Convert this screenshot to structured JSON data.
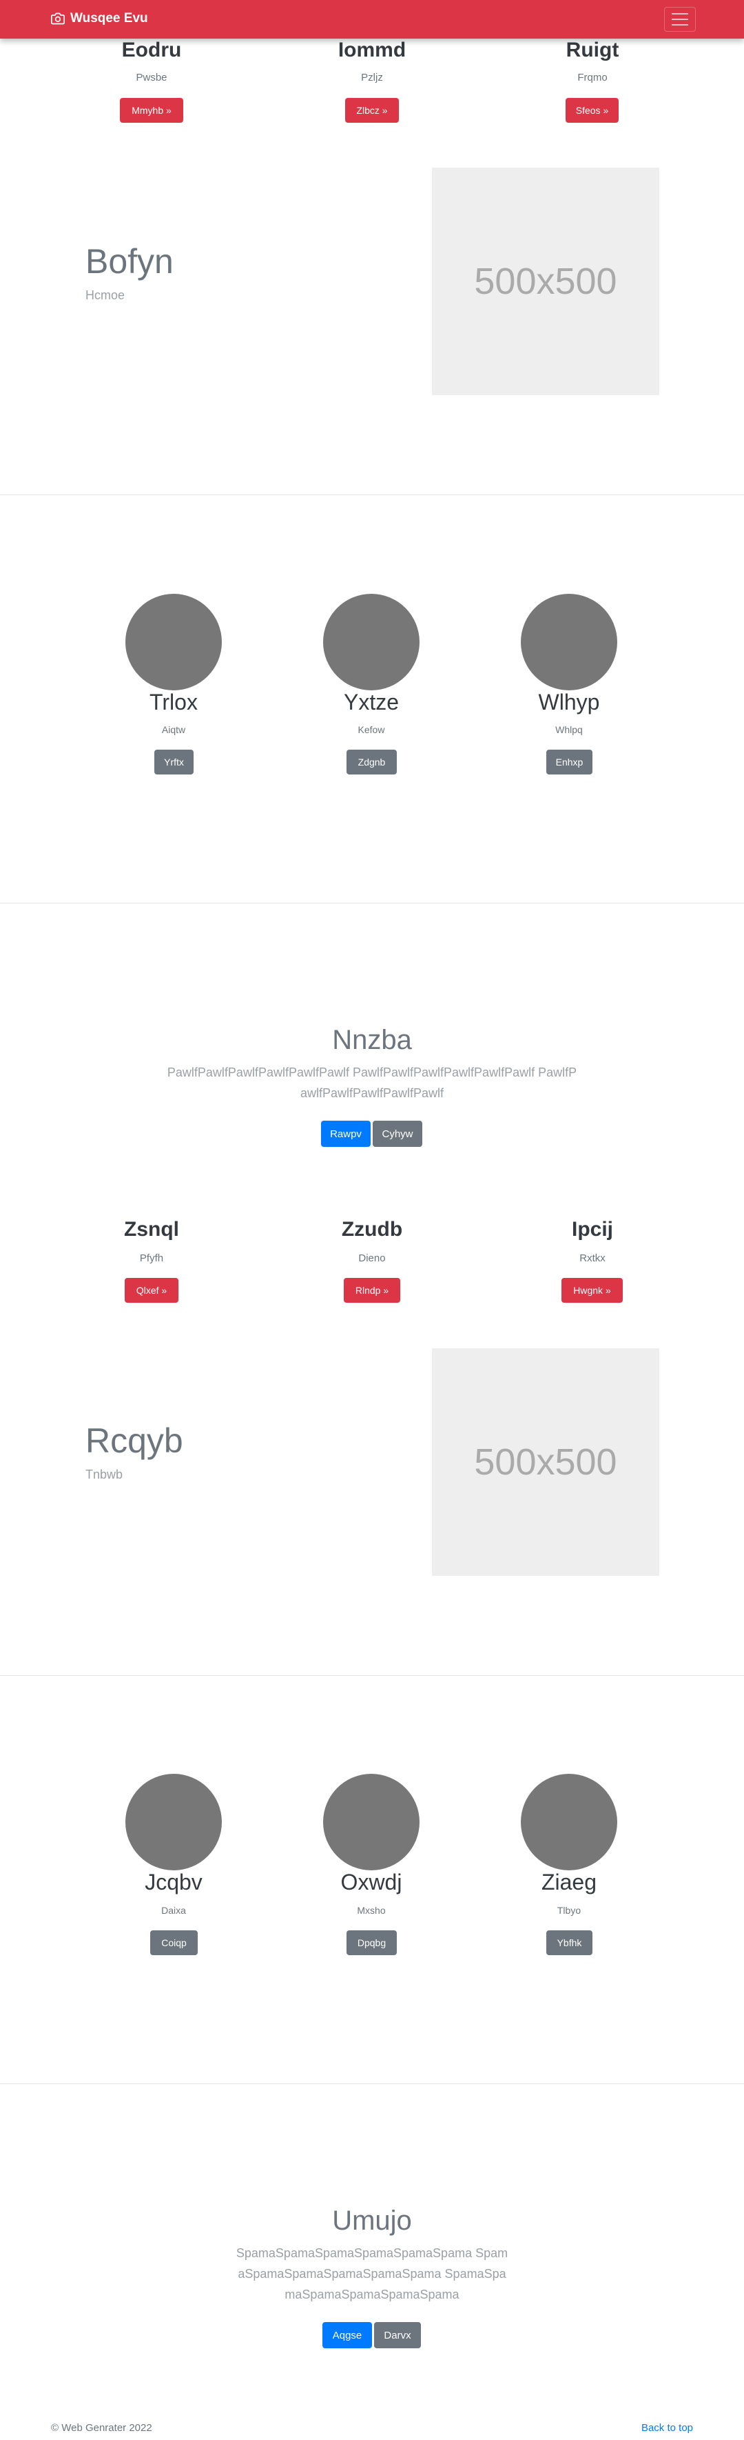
{
  "navbar": {
    "brand": "Wusqee Evu"
  },
  "features1": [
    {
      "title": "Eodru",
      "sub": "Pwsbe",
      "button": "Mmyhb »"
    },
    {
      "title": "Iommd",
      "sub": "Pzljz",
      "button": "Zlbcz »"
    },
    {
      "title": "Ruigt",
      "sub": "Frqmo",
      "button": "Sfeos »"
    }
  ],
  "hero1": {
    "title": "Bofyn",
    "subtitle": "Hcmoe",
    "image_label": "500x500"
  },
  "team1": [
    {
      "name": "Trlox",
      "role": "Aiqtw",
      "button": "Yrftx"
    },
    {
      "name": "Yxtze",
      "role": "Kefow",
      "button": "Zdgnb"
    },
    {
      "name": "Wlhyp",
      "role": "Whlpq",
      "button": "Enhxp"
    }
  ],
  "section1": {
    "title": "Nnzba",
    "text": "PawlfPawlfPawlfPawlfPawlfPawlf PawlfPawlfPawlfPawlfPawlfPawlf PawlfPawlfPawlfPawlfPawlfPawlf",
    "primary": "Rawpv",
    "secondary": "Cyhyw"
  },
  "features2": [
    {
      "title": "Zsnql",
      "sub": "Pfyfh",
      "button": "Qlxef »"
    },
    {
      "title": "Zzudb",
      "sub": "Dieno",
      "button": "Rlndp »"
    },
    {
      "title": "Ipcij",
      "sub": "Rxtkx",
      "button": "Hwgnk »"
    }
  ],
  "hero2": {
    "title": "Rcqyb",
    "subtitle": "Tnbwb",
    "image_label": "500x500"
  },
  "team2": [
    {
      "name": "Jcqbv",
      "role": "Daixa",
      "button": "Coiqp"
    },
    {
      "name": "Oxwdj",
      "role": "Mxsho",
      "button": "Dpqbg"
    },
    {
      "name": "Ziaeg",
      "role": "Tlbyo",
      "button": "Ybfhk"
    }
  ],
  "section2": {
    "title": "Umujo",
    "text": "SpamaSpamaSpamaSpamaSpamaSpama SpamaSpamaSpamaSpamaSpamaSpama SpamaSpamaSpamaSpamaSpamaSpama",
    "primary": "Aqgse",
    "secondary": "Darvx"
  },
  "footer": {
    "copyright": "© Web Genrater 2022",
    "back_to_top": "Back to top"
  }
}
